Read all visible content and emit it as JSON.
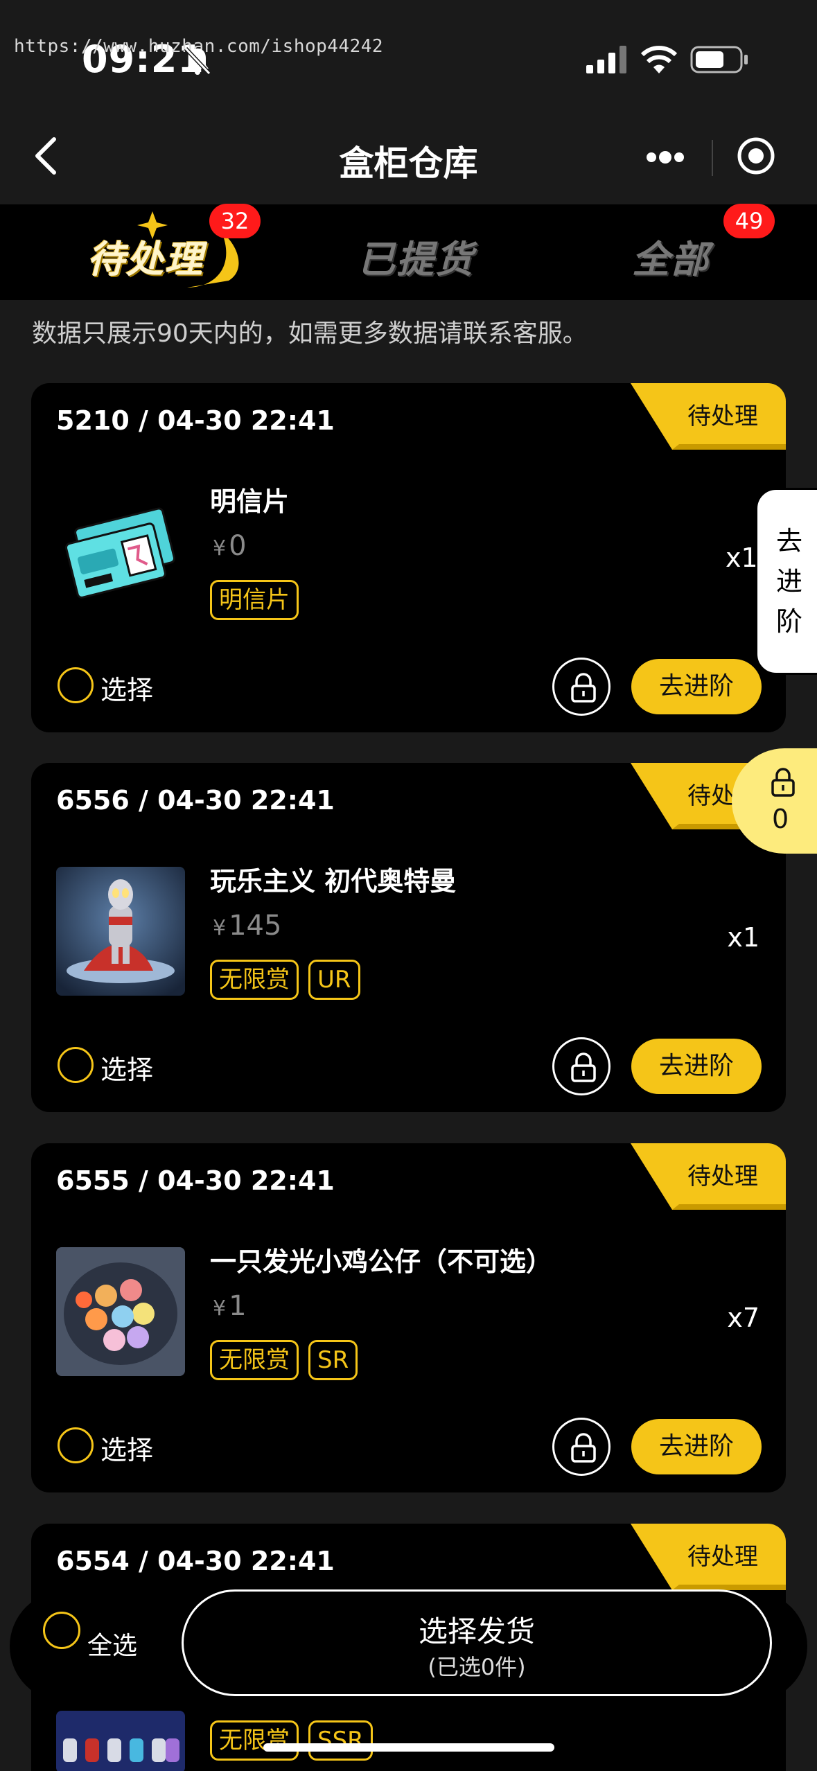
{
  "status_bar": {
    "watermark": "https://www.huzhan.com/ishop44242",
    "time": "09:21",
    "icons": [
      "bell-off-icon",
      "signal-icon",
      "wifi-icon",
      "battery-icon"
    ]
  },
  "nav": {
    "title": "盒柜仓库",
    "back_icon": "chevron-left-icon",
    "more_icon": "more-dots-icon",
    "close_icon": "target-close-icon"
  },
  "tabs": [
    {
      "label": "待处理",
      "badge": "32",
      "active": true
    },
    {
      "label": "已提货",
      "badge": null,
      "active": false
    },
    {
      "label": "全部",
      "badge": "49",
      "active": false
    }
  ],
  "notice": "数据只展示90天内的，如需更多数据请联系客服。",
  "cards": [
    {
      "id_time": "5210 / 04-30 22:41",
      "status": "待处理",
      "name": "明信片",
      "price": "0",
      "tags": [
        "明信片"
      ],
      "qty": "x197",
      "select_label": "选择",
      "advance_label": "去进阶"
    },
    {
      "id_time": "6556 / 04-30 22:41",
      "status": "待处理",
      "name": "玩乐主义 初代奥特曼",
      "price": "145",
      "tags": [
        "无限赏",
        "UR"
      ],
      "qty": "x1",
      "select_label": "选择",
      "advance_label": "去进阶"
    },
    {
      "id_time": "6555 / 04-30 22:41",
      "status": "待处理",
      "name": "一只发光小鸡公仔（不可选）",
      "price": "1",
      "tags": [
        "无限赏",
        "SR"
      ],
      "qty": "x7",
      "select_label": "选择",
      "advance_label": "去进阶"
    },
    {
      "id_time": "6554 / 04-30 22:41",
      "status": "待处理",
      "name": "",
      "price": "",
      "tags": [
        "无限赏",
        "SSR"
      ],
      "qty": "",
      "select_label": "",
      "advance_label": ""
    }
  ],
  "currency_symbol": "¥",
  "side_advance": "去进阶",
  "side_lock_count": "0",
  "bottom": {
    "select_all": "全选",
    "ship_label": "选择发货",
    "ship_count": "(已选0件)"
  },
  "colors": {
    "accent": "#f5c518",
    "badge": "#ff1a1a",
    "card": "#000000",
    "background": "#1a1a1a"
  }
}
